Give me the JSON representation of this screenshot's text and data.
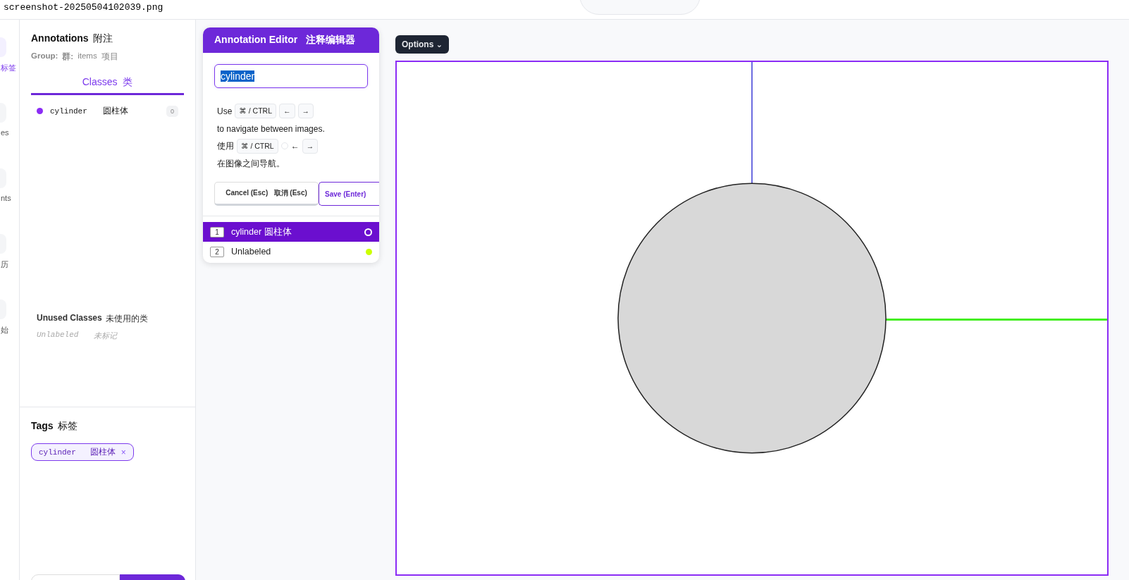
{
  "file_title": "screenshot-20250504102039.png",
  "rail": [
    {
      "label": "标签",
      "selected": true
    },
    {
      "label": "es",
      "selected": false
    },
    {
      "label": "nts",
      "selected": false
    },
    {
      "label": "历",
      "selected": false
    },
    {
      "label": "始",
      "selected": false
    }
  ],
  "annotations": {
    "title": "Annotations",
    "title_cn": "附注",
    "group_label": "Group:",
    "group_label_cn": "群:",
    "group_value": "items",
    "group_value_cn": "项目",
    "tab": {
      "label": "Classes",
      "label_cn": "类",
      "selected": true
    },
    "classes": [
      {
        "name": "cylinder",
        "name_cn": "圆柱体",
        "count": "0",
        "color": "#8b2cf5"
      }
    ],
    "unused_title": "Unused Classes",
    "unused_title_cn": "未使用的类",
    "unused": [
      {
        "name": "Unlabeled",
        "name_cn": "未标记"
      }
    ]
  },
  "tags": {
    "title": "Tags",
    "title_cn": "标签",
    "items": [
      {
        "name": "cylinder",
        "name_cn": "圆柱体",
        "remove": "×"
      }
    ]
  },
  "editor": {
    "title": "Annotation Editor",
    "title_cn": "注释编辑器",
    "value": "cylinder",
    "hints": [
      [
        {
          "kind": "text",
          "text": "Use"
        },
        {
          "kind": "key",
          "text": "⌘ / CTRL"
        },
        {
          "kind": "key",
          "text": "←"
        },
        {
          "kind": "key",
          "text": "→"
        },
        {
          "kind": "text",
          "text": "to navigate between images."
        }
      ],
      [
        {
          "kind": "text",
          "text": "使用"
        },
        {
          "kind": "key",
          "text": "⌘ / CTRL"
        },
        {
          "kind": "blank"
        },
        {
          "kind": "glyph",
          "text": "←"
        },
        {
          "kind": "key",
          "text": "→"
        },
        {
          "kind": "text",
          "text": "在图像之间导航。"
        }
      ]
    ],
    "cancel": "Cancel (Esc)",
    "cancel_cn": "取消 (Esc)",
    "save": "Save (Enter)",
    "items": [
      {
        "index": "1",
        "label": "cylinder 圆柱体",
        "selected": true,
        "color": "#ffffff"
      },
      {
        "index": "2",
        "label": "Unlabeled",
        "selected": false,
        "color": "#ccff00"
      }
    ]
  },
  "options": {
    "label": "Options",
    "caret": "⌄"
  }
}
